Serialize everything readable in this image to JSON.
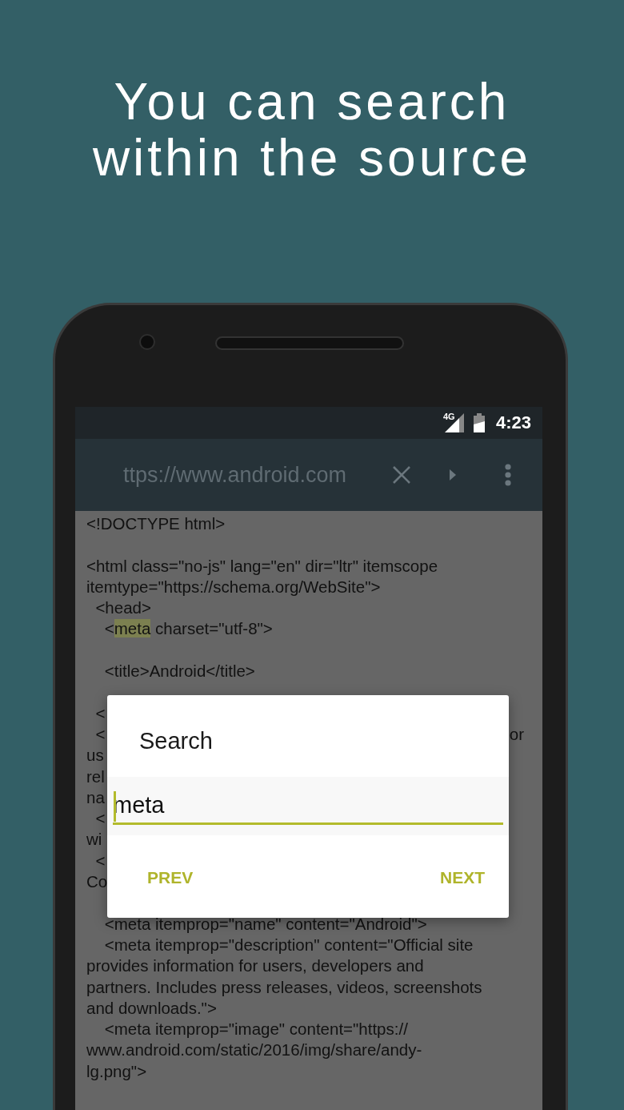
{
  "headline_lines": [
    "You can search",
    "within the source"
  ],
  "status_bar": {
    "network": "4G",
    "time": "4:23"
  },
  "toolbar": {
    "url": "ttps://www.android.com"
  },
  "source_lines": [
    {
      "text": "<!DOCTYPE html>"
    },
    {
      "text": "<html class=\"no-js\" lang=\"en\" dir=\"ltr\" itemscope",
      "blank_before": true
    },
    {
      "text": "itemtype=\"https://schema.org/WebSite\">"
    },
    {
      "text": "  <head>"
    },
    {
      "segments": [
        {
          "text": "    <",
          "highlighted": false
        },
        {
          "text": "meta",
          "highlighted": true
        },
        {
          "text": " charset=\"utf-8\">",
          "highlighted": false
        }
      ]
    },
    {
      "text": "    <title>Android</title>",
      "blank_before": true
    },
    {
      "text": "  <",
      "blank_before": true
    },
    {
      "text": "  <",
      "tail": "or"
    },
    {
      "text": "us"
    },
    {
      "text": "rel"
    },
    {
      "text": "na"
    },
    {
      "text": "  <"
    },
    {
      "text": "wi"
    },
    {
      "text": "  <"
    },
    {
      "text": "Co"
    },
    {
      "text": "    <meta itemprop=\"name\" content=\"Android\">",
      "blank_before": true
    },
    {
      "text": "    <meta itemprop=\"description\" content=\"Official site"
    },
    {
      "text": "provides information for users, developers and"
    },
    {
      "text": "partners. Includes press releases, videos, screenshots"
    },
    {
      "text": "and downloads.\">"
    },
    {
      "text": "    <meta itemprop=\"image\" content=\"https://"
    },
    {
      "text": "www.android.com/static/2016/img/share/andy-"
    },
    {
      "text": "lg.png\">"
    }
  ],
  "dialog": {
    "title": "Search",
    "field": {
      "value": "meta",
      "focused": true
    },
    "buttons": [
      "PREV",
      "NEXT"
    ]
  }
}
